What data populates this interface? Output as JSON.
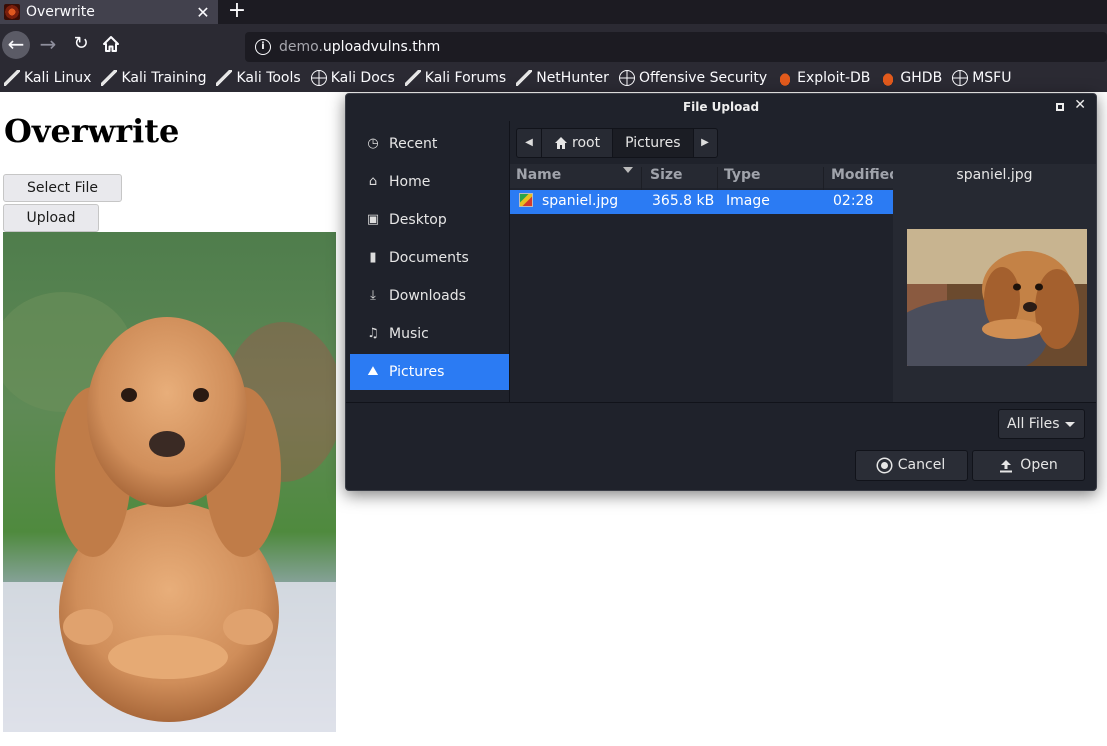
{
  "browser": {
    "tab": {
      "title": "Overwrite",
      "close": "✕"
    },
    "new_tab": "+",
    "url": {
      "host_prefix": "demo.",
      "host_main": "uploadvulns.thm"
    },
    "bookmarks": [
      {
        "label": "Kali Linux",
        "icon": "kali-dragon-icon"
      },
      {
        "label": "Kali Training",
        "icon": "kali-dragon-icon"
      },
      {
        "label": "Kali Tools",
        "icon": "kali-dragon-icon"
      },
      {
        "label": "Kali Docs",
        "icon": "globe-icon"
      },
      {
        "label": "Kali Forums",
        "icon": "kali-dragon-icon"
      },
      {
        "label": "NetHunter",
        "icon": "kali-dragon-icon"
      },
      {
        "label": "Offensive Security",
        "icon": "globe-icon"
      },
      {
        "label": "Exploit-DB",
        "icon": "exploitdb-icon"
      },
      {
        "label": "GHDB",
        "icon": "exploitdb-icon"
      },
      {
        "label": "MSFU",
        "icon": "globe-icon"
      }
    ]
  },
  "page": {
    "title": "Overwrite",
    "select_file": "Select File",
    "upload": "Upload"
  },
  "dialog": {
    "title": "File Upload",
    "sidebar": [
      {
        "label": "Recent",
        "icon": "clock-icon",
        "active": false
      },
      {
        "label": "Home",
        "icon": "home-icon",
        "active": false
      },
      {
        "label": "Desktop",
        "icon": "desktop-icon",
        "active": false
      },
      {
        "label": "Documents",
        "icon": "document-icon",
        "active": false
      },
      {
        "label": "Downloads",
        "icon": "download-icon",
        "active": false
      },
      {
        "label": "Music",
        "icon": "music-icon",
        "active": false
      },
      {
        "label": "Pictures",
        "icon": "pictures-icon",
        "active": true
      }
    ],
    "path": {
      "root": "root",
      "current": "Pictures"
    },
    "columns": {
      "name": "Name",
      "size": "Size",
      "type": "Type",
      "modified": "Modified"
    },
    "files": [
      {
        "name": "spaniel.jpg",
        "size": "365.8 kB",
        "type": "Image",
        "modified": "02:28",
        "selected": true
      }
    ],
    "preview_name": "spaniel.jpg",
    "filter": "All Files",
    "cancel": "Cancel",
    "open": "Open"
  },
  "colors": {
    "accent": "#2b7bf3",
    "dialog_bg": "#1f222b",
    "browser_toolbar": "#2b2a33"
  }
}
